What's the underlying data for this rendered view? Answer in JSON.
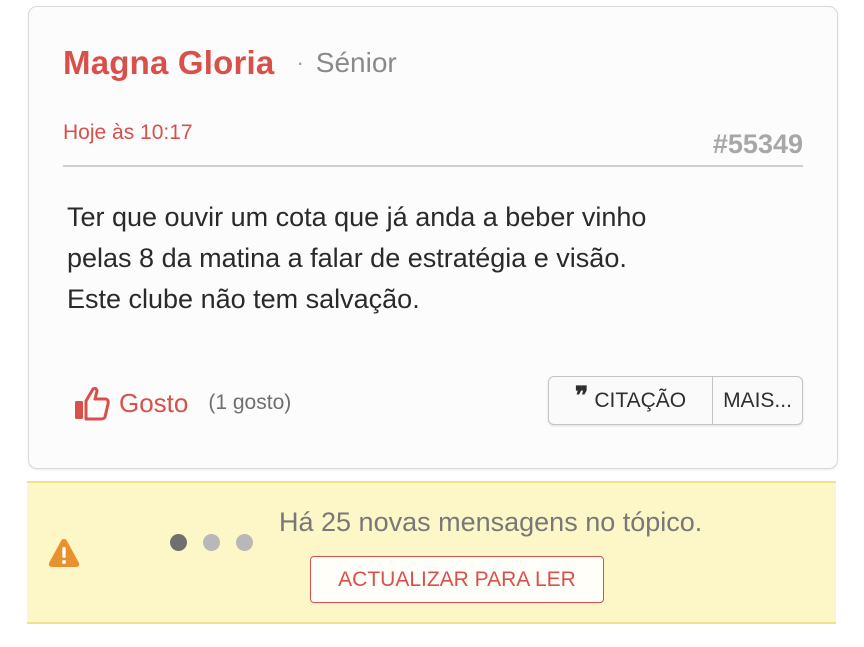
{
  "post": {
    "author": "Magna Gloria",
    "separator": "·",
    "rank": "Sénior",
    "time": "Hoje às 10:17",
    "number": "#55349",
    "body_lines": [
      "Ter que ouvir um cota que já anda a beber vinho",
      "pelas 8 da matina a falar de estratégia e visão.",
      "Este clube não tem salvação."
    ],
    "like_label": "Gosto",
    "like_count": "(1 gosto)",
    "like_icon": "thumbs-up-icon",
    "quote_label": "CITAÇÃO",
    "quote_glyph": "❞",
    "more_label": "MAIS..."
  },
  "notice": {
    "icon": "alert-icon",
    "text": "Há 25 novas mensagens no tópico.",
    "button_label": "ACTUALIZAR PARA LER"
  },
  "colors": {
    "accent": "#d9504b",
    "notice_bg": "#fdf6c7",
    "alert": "#e8922f"
  }
}
